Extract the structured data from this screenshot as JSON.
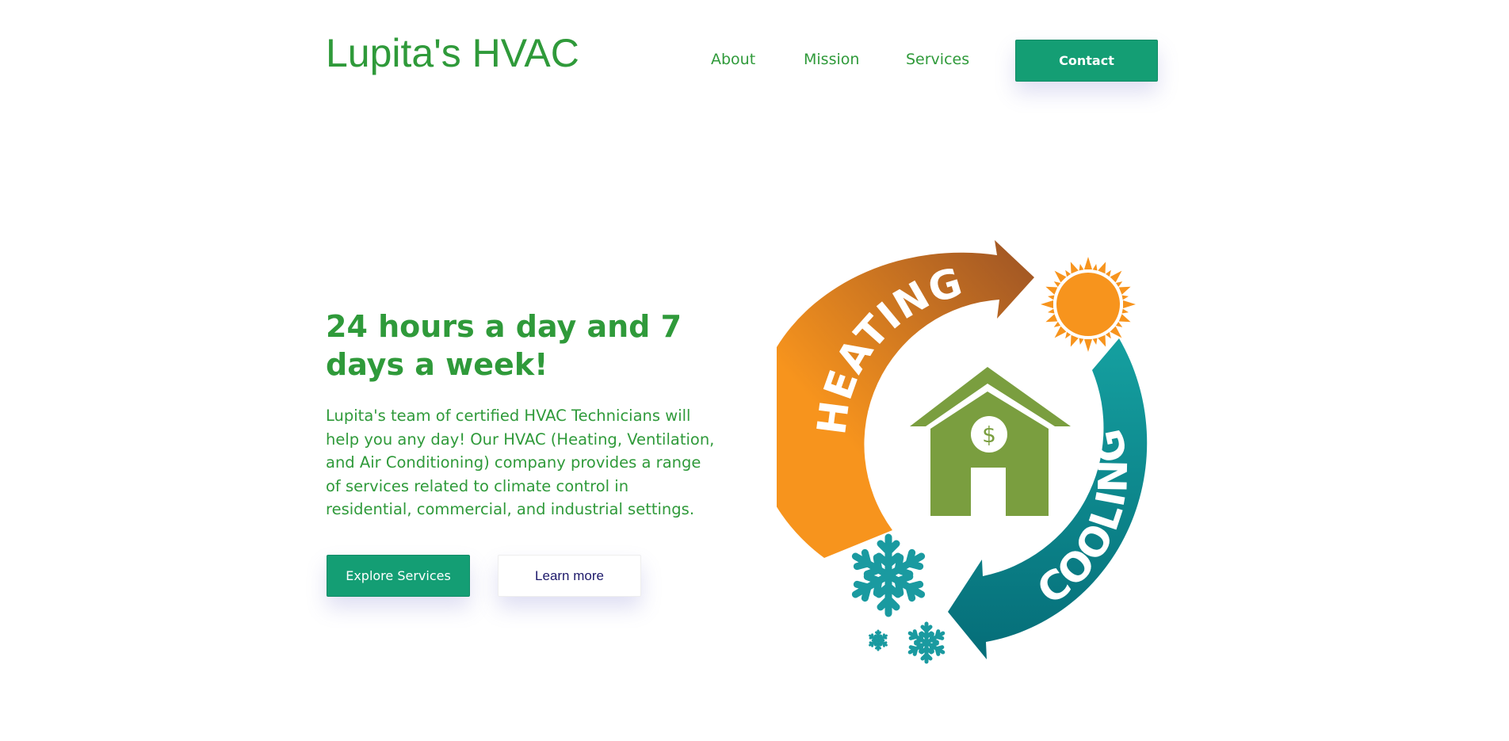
{
  "header": {
    "brand": "Lupita's HVAC",
    "nav": [
      "About",
      "Mission",
      "Services"
    ],
    "contact_label": "Contact"
  },
  "hero": {
    "title": "24 hours a day and 7 days a week!",
    "description": "Lupita's team of certified HVAC Technicians will help you any day! Our HVAC (Heating, Ventilation, and Air Conditioning) company provides a range of services related to climate control in residential, commercial, and industrial settings.",
    "primary_button": "Explore Services",
    "secondary_button": "Learn more"
  },
  "illustration": {
    "heating_label": "HEATING",
    "cooling_label": "COOLING",
    "currency_symbol": "$",
    "colors": {
      "heating_start": "#f7941d",
      "heating_end": "#9c5325",
      "cooling_start": "#15a0a0",
      "cooling_end": "#056d78",
      "sun": "#f7941d",
      "house": "#7a9e3f",
      "snowflake": "#1a9aa0"
    },
    "icons": [
      "sun-icon",
      "house-icon",
      "dollar-icon",
      "snowflake-icon"
    ]
  },
  "theme": {
    "text_green": "#2f9a3a",
    "button_teal": "#149e74",
    "learn_more_text": "#1e1a6b"
  }
}
